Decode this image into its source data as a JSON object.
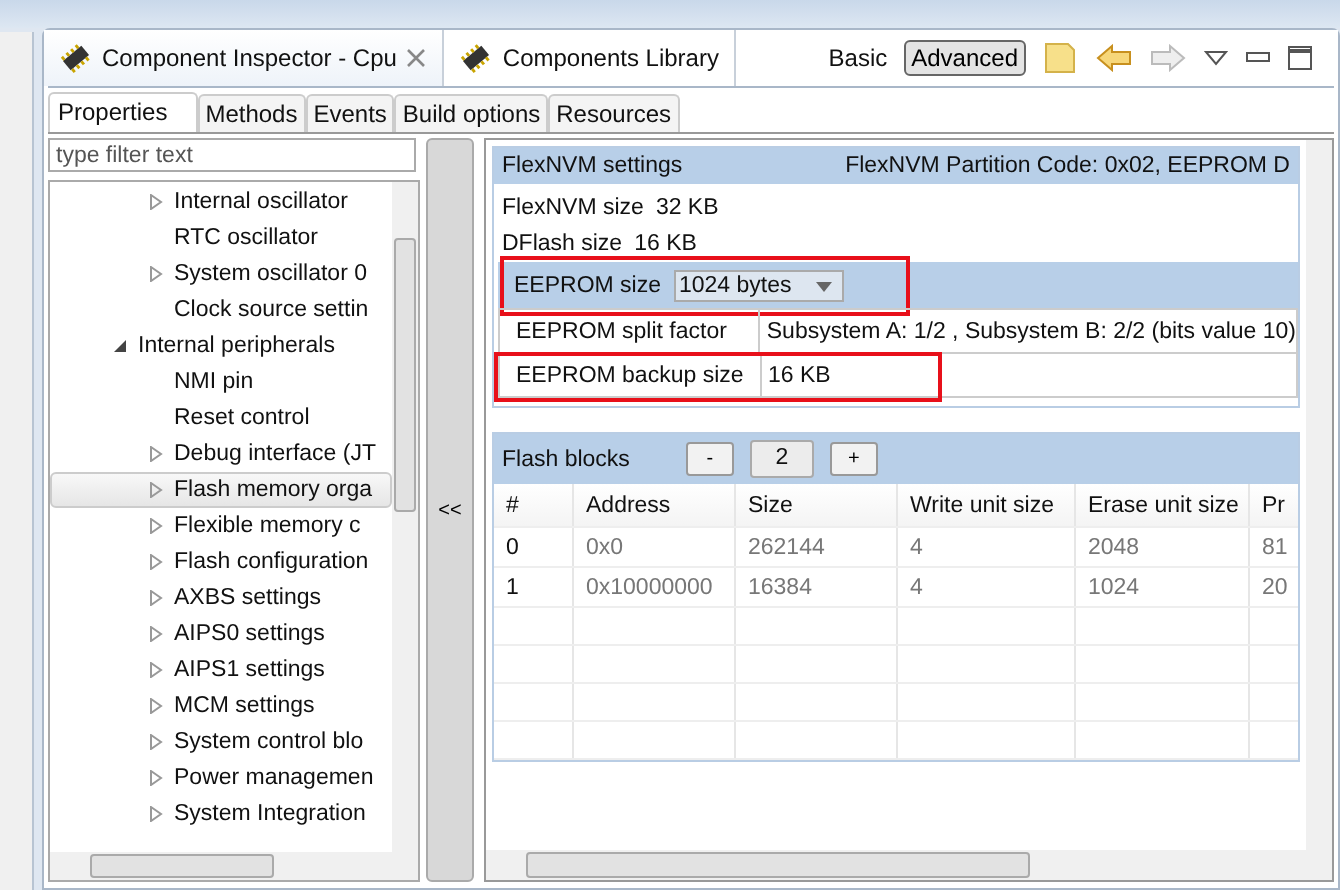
{
  "editor_tabs": [
    {
      "label": "Component Inspector - Cpu",
      "selected": true,
      "closable": true
    },
    {
      "label": "Components Library",
      "selected": false,
      "closable": false
    }
  ],
  "mode": {
    "label": "Basic",
    "buttons": [
      {
        "label": "Advanced",
        "selected": true
      }
    ]
  },
  "toolbar": {
    "back_disabled": false,
    "forward_disabled": true
  },
  "inner_tabs": [
    {
      "label": "Properties",
      "selected": true
    },
    {
      "label": "Methods",
      "selected": false
    },
    {
      "label": "Events",
      "selected": false
    },
    {
      "label": "Build options",
      "selected": false
    },
    {
      "label": "Resources",
      "selected": false
    }
  ],
  "filter": {
    "placeholder": "type filter text"
  },
  "tree": [
    {
      "children": [
        {
          "label": "Internal oscillator",
          "expanded": false,
          "selected": false
        },
        {
          "label": "RTC oscillator",
          "selected": false
        },
        {
          "label": "System oscillator 0",
          "expanded": false,
          "selected": false
        },
        {
          "label": "Clock source settin",
          "selected": false
        }
      ]
    },
    {
      "label": "Internal peripherals",
      "expanded": true,
      "selected": false,
      "children": [
        {
          "label": "NMI pin",
          "selected": false
        },
        {
          "label": "Reset control",
          "selected": false
        },
        {
          "label": "Debug interface (JT",
          "expanded": false,
          "selected": false
        },
        {
          "label": "Flash memory orga",
          "expanded": false,
          "selected": true
        },
        {
          "label": "Flexible memory c",
          "expanded": false,
          "selected": false
        },
        {
          "label": "Flash configuration",
          "expanded": false,
          "selected": false
        },
        {
          "label": "AXBS settings",
          "expanded": false,
          "selected": false
        },
        {
          "label": "AIPS0 settings",
          "expanded": false,
          "selected": false
        },
        {
          "label": "AIPS1 settings",
          "expanded": false,
          "selected": false
        },
        {
          "label": "MCM settings",
          "expanded": false,
          "selected": false
        },
        {
          "label": "System control blo",
          "expanded": false,
          "selected": false
        },
        {
          "label": "Power managemen",
          "expanded": false,
          "selected": false
        },
        {
          "label": "System Integration",
          "expanded": false,
          "selected": false
        }
      ]
    }
  ],
  "collapse_button": "<<",
  "flexnvm": {
    "title": "FlexNVM settings",
    "summary": "FlexNVM Partition Code: 0x02, EEPROM D",
    "properties": [
      {
        "kind": "text",
        "label": "FlexNVM size",
        "value": "32 KB",
        "highlighted": false
      },
      {
        "kind": "text",
        "label": "DFlash size",
        "value": "16 KB",
        "highlighted": false
      },
      {
        "kind": "dropdown",
        "label": "EEPROM size",
        "value": "1024 bytes",
        "highlighted": true
      },
      {
        "kind": "field",
        "label": "EEPROM split factor",
        "value": "Subsystem A: 1/2 , Subsystem B: 2/2 (bits value 10)",
        "highlighted": false
      },
      {
        "kind": "field",
        "label": "EEPROM backup size",
        "value": "16 KB",
        "highlighted": true
      }
    ]
  },
  "flash_blocks": {
    "title": "Flash blocks",
    "decrement": "-",
    "count": "2",
    "increment": "+",
    "columns": [
      "#",
      "Address",
      "Size",
      "Write unit size",
      "Erase unit size",
      "Pr"
    ],
    "rows": [
      [
        "0",
        "0x0",
        "262144",
        "4",
        "2048",
        "81"
      ],
      [
        "1",
        "0x10000000",
        "16384",
        "4",
        "1024",
        "20"
      ]
    ]
  }
}
